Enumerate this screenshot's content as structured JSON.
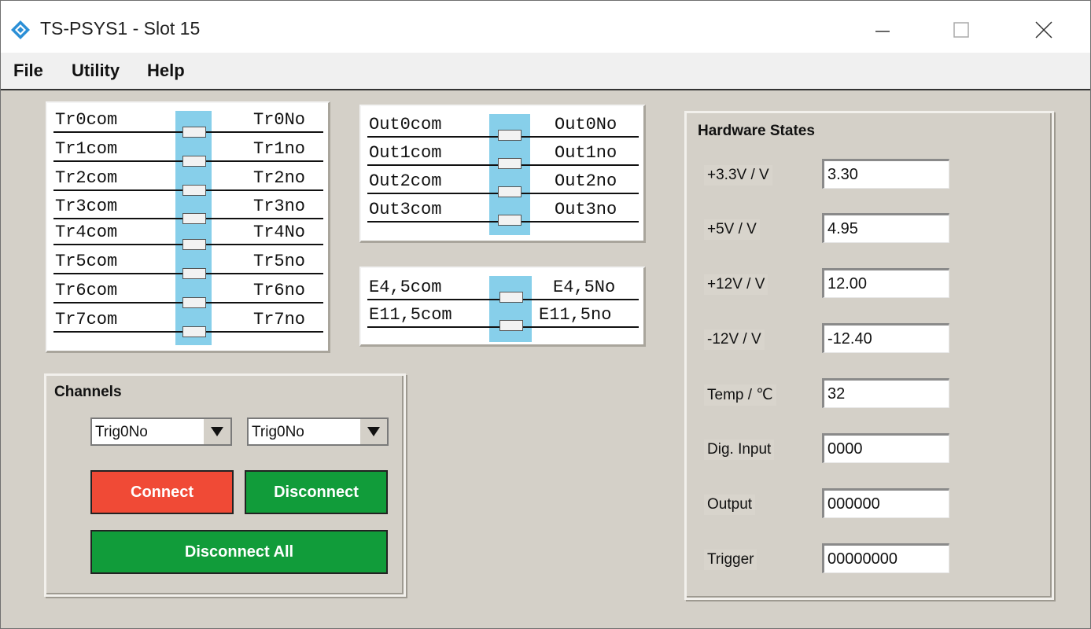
{
  "window": {
    "title": "TS-PSYS1 - Slot 15"
  },
  "menu": [
    "File",
    "Utility",
    "Help"
  ],
  "tr_relays": [
    {
      "com": "Tr0com",
      "no": "Tr0No"
    },
    {
      "com": "Tr1com",
      "no": "Tr1no"
    },
    {
      "com": "Tr2com",
      "no": "Tr2no"
    },
    {
      "com": "Tr3com",
      "no": "Tr3no"
    },
    {
      "com": "Tr4com",
      "no": "Tr4No"
    },
    {
      "com": "Tr5com",
      "no": "Tr5no"
    },
    {
      "com": "Tr6com",
      "no": "Tr6no"
    },
    {
      "com": "Tr7com",
      "no": "Tr7no"
    }
  ],
  "out_relays": [
    {
      "com": "Out0com",
      "no": "Out0No"
    },
    {
      "com": "Out1com",
      "no": "Out1no"
    },
    {
      "com": "Out2com",
      "no": "Out2no"
    },
    {
      "com": "Out3com",
      "no": "Out3no"
    }
  ],
  "e_relays": [
    {
      "com": "E4,5com",
      "no": "E4,5No"
    },
    {
      "com": "E11,5com",
      "no": "E11,5no"
    }
  ],
  "channels": {
    "title": "Channels",
    "select1": "Trig0No",
    "select2": "Trig0No",
    "connect": "Connect",
    "disconnect": "Disconnect",
    "disconnect_all": "Disconnect All"
  },
  "hardware": {
    "title": "Hardware States",
    "rows": [
      {
        "label": "+3.3V / V",
        "value": "3.30"
      },
      {
        "label": "+5V / V",
        "value": "4.95"
      },
      {
        "label": "+12V / V",
        "value": "12.00"
      },
      {
        "label": "-12V / V",
        "value": "-12.40"
      },
      {
        "label": "Temp / ℃",
        "value": "32"
      },
      {
        "label": "Dig. Input",
        "value": "0000"
      },
      {
        "label": "Output",
        "value": "000000"
      },
      {
        "label": "Trigger",
        "value": "00000000"
      }
    ]
  },
  "colors": {
    "relay_bar": "#87cfea",
    "connect": "#f04a36",
    "disconnect": "#119c3a"
  }
}
